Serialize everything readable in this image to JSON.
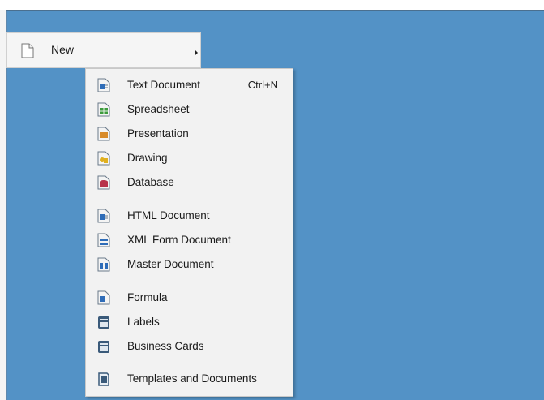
{
  "menu": {
    "new_label": "New"
  },
  "submenu": {
    "items": [
      {
        "label": "Text Document",
        "shortcut": "Ctrl+N",
        "icon": "text-document-icon",
        "color": "#2e6cb8"
      },
      {
        "label": "Spreadsheet",
        "icon": "spreadsheet-icon",
        "color": "#3c9b3c"
      },
      {
        "label": "Presentation",
        "icon": "presentation-icon",
        "color": "#d88b2a"
      },
      {
        "label": "Drawing",
        "icon": "drawing-icon",
        "color": "#e0b020"
      },
      {
        "label": "Database",
        "icon": "database-icon",
        "color": "#b8324a"
      },
      {
        "label": "HTML Document",
        "icon": "html-document-icon",
        "color": "#2e6cb8"
      },
      {
        "label": "XML Form Document",
        "icon": "xml-form-document-icon",
        "color": "#2e6cb8"
      },
      {
        "label": "Master Document",
        "icon": "master-document-icon",
        "color": "#2e6cb8"
      },
      {
        "label": "Formula",
        "icon": "formula-icon",
        "color": "#2e6cb8"
      },
      {
        "label": "Labels",
        "icon": "labels-icon",
        "color": "#3a5a7a"
      },
      {
        "label": "Business Cards",
        "icon": "business-cards-icon",
        "color": "#3a5a7a"
      },
      {
        "label": "Templates and Documents",
        "icon": "templates-icon",
        "color": "#3a5a7a"
      }
    ]
  }
}
